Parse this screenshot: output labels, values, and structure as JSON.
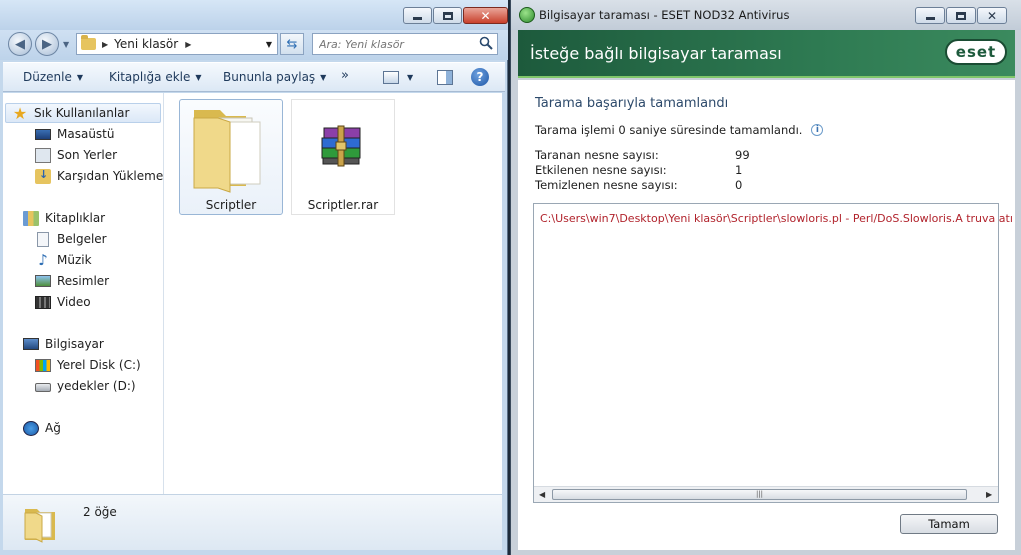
{
  "explorer": {
    "address": {
      "current_folder": "Yeni klasör"
    },
    "search": {
      "placeholder": "Ara: Yeni klasör"
    },
    "toolbar": {
      "organize_label": "Düzenle",
      "include_library_label": "Kitaplığa ekle",
      "share_label": "Bununla paylaş",
      "more_label": "»"
    },
    "nav": {
      "favorites_header": "Sık Kullanılanlar",
      "favorites": [
        "Masaüstü",
        "Son Yerler",
        "Karşıdan Yüklemeler"
      ],
      "libraries_header": "Kitaplıklar",
      "libraries": [
        "Belgeler",
        "Müzik",
        "Resimler",
        "Video"
      ],
      "computer_header": "Bilgisayar",
      "drives": [
        "Yerel Disk (C:)",
        "yedekler (D:)"
      ],
      "network_header": "Ağ"
    },
    "files": [
      {
        "name": "Scriptler",
        "type": "folder",
        "selected": true
      },
      {
        "name": "Scriptler.rar",
        "type": "winrar-archive",
        "selected": false
      }
    ],
    "status": {
      "item_count": "2 öğe"
    }
  },
  "eset": {
    "window_title": "Bilgisayar taraması - ESET NOD32 Antivirus",
    "header_title": "İsteğe bağlı bilgisayar taraması",
    "logo_text": "eset",
    "heading": "Tarama başarıyla tamamlandı",
    "duration_text": "Tarama işlemi 0 saniye süresinde tamamlandı.",
    "stats": [
      {
        "label": "Taranan nesne sayısı:",
        "value": "99"
      },
      {
        "label": "Etkilenen nesne sayısı:",
        "value": "1"
      },
      {
        "label": "Temizlenen nesne sayısı:",
        "value": "0"
      }
    ],
    "log": [
      "C:\\Users\\win7\\Desktop\\Yeni klasör\\Scriptler\\slowloris.pl - Perl/DoS.Slowloris.A truva atı"
    ],
    "ok_label": "Tamam"
  },
  "colors": {
    "eset_header": "#2e7a52",
    "log_text": "#b1232c",
    "heading_text": "#2d4a6b"
  },
  "icons": [
    "back-arrow-icon",
    "forward-arrow-icon",
    "refresh-icon",
    "search-icon",
    "help-icon",
    "star-icon",
    "folder-icon",
    "winrar-icon",
    "info-icon",
    "eset-logo"
  ]
}
